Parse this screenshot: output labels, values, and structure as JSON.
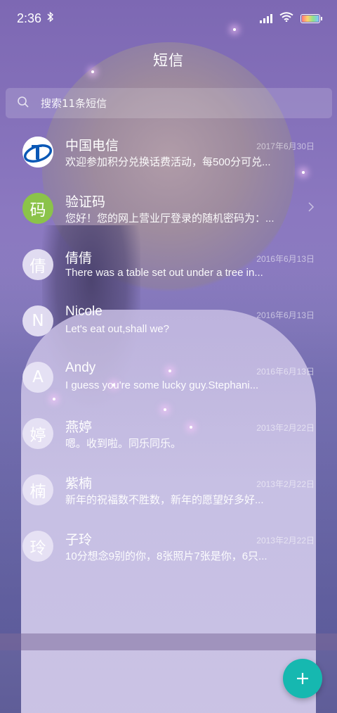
{
  "status_bar": {
    "time": "2:36"
  },
  "header": {
    "title": "短信"
  },
  "search": {
    "placeholder": "搜索11条短信"
  },
  "conversations": [
    {
      "avatar_type": "telecom-logo",
      "avatar_text": "",
      "name": "中国电信",
      "date": "2017年6月30日",
      "preview": "欢迎参加积分兑换话费活动，每500分可兑..."
    },
    {
      "avatar_type": "green",
      "avatar_text": "码",
      "name": "验证码",
      "date": "",
      "preview": "您好！您的网上营业厅登录的随机密码为：..."
    },
    {
      "avatar_type": "soft",
      "avatar_text": "倩",
      "name": "倩倩",
      "date": "2016年6月13日",
      "preview": "There was a table set out under a tree in..."
    },
    {
      "avatar_type": "soft",
      "avatar_text": "N",
      "name": "Nicole",
      "date": "2016年6月13日",
      "preview": "Let's eat out,shall we?"
    },
    {
      "avatar_type": "soft",
      "avatar_text": "A",
      "name": "Andy",
      "date": "2016年6月13日",
      "preview": "I guess you're some lucky guy.Stephani..."
    },
    {
      "avatar_type": "soft",
      "avatar_text": "婷",
      "name": "燕婷",
      "date": "2013年2月22日",
      "preview": "嗯。收到啦。同乐同乐。"
    },
    {
      "avatar_type": "soft",
      "avatar_text": "楠",
      "name": "紫楠",
      "date": "2013年2月22日",
      "preview": "新年的祝福数不胜数，新年的愿望好多好..."
    },
    {
      "avatar_type": "soft",
      "avatar_text": "玲",
      "name": "子玲",
      "date": "2013年2月22日",
      "preview": "10分想念9别的你，8张照片7张是你，6只..."
    }
  ],
  "icons": {
    "search": "search-icon",
    "compose": "plus-icon",
    "chevron": "chevron-right-icon"
  },
  "colors": {
    "fab": "#16b8b0",
    "verify_avatar": "#8bc34a"
  }
}
